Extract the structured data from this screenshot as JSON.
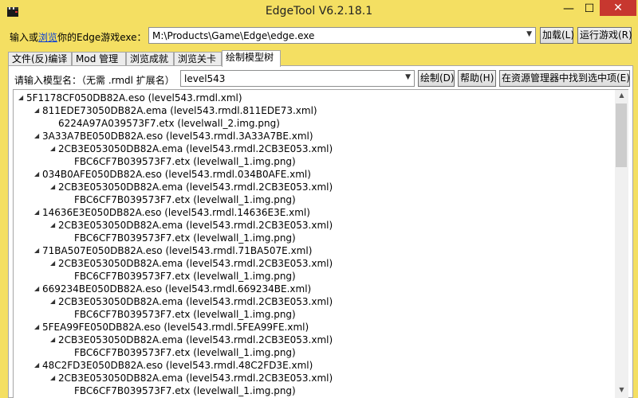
{
  "window": {
    "title": "EdgeTool V6.2.18.1",
    "min": "—",
    "max": "☐",
    "close": "✕"
  },
  "exe": {
    "label_pre": "输入或",
    "label_link": "浏览",
    "label_post": "你的Edge游戏exe：",
    "path": "M:\\Products\\Game\\Edge\\edge.exe",
    "load": "加载(L)",
    "run": "运行游戏(R)"
  },
  "tabs": [
    "文件(反)编译",
    "Mod 管理",
    "浏览成就",
    "浏览关卡",
    "绘制模型树"
  ],
  "model": {
    "label": "请输入模型名：（无需 .rmdl 扩展名）",
    "value": "level543",
    "draw": "绘制(D)",
    "help": "帮助(H)",
    "locate": "在资源管理器中找到选中项(E)"
  },
  "tree": [
    {
      "level": 0,
      "expanded": true,
      "text": "5F1178CF050DB82A.eso (level543.rmdl.xml)"
    },
    {
      "level": 1,
      "expanded": true,
      "text": "811EDE73050DB82A.ema (level543.rmdl.811EDE73.xml)"
    },
    {
      "level": 2,
      "expanded": false,
      "text": "6224A97A039573F7.etx (levelwall_2.img.png)"
    },
    {
      "level": 1,
      "expanded": true,
      "text": "3A33A7BE050DB82A.eso (level543.rmdl.3A33A7BE.xml)"
    },
    {
      "level": 2,
      "expanded": true,
      "text": "2CB3E053050DB82A.ema (level543.rmdl.2CB3E053.xml)"
    },
    {
      "level": 3,
      "expanded": false,
      "text": "FBC6CF7B039573F7.etx (levelwall_1.img.png)"
    },
    {
      "level": 1,
      "expanded": true,
      "text": "034B0AFE050DB82A.eso (level543.rmdl.034B0AFE.xml)"
    },
    {
      "level": 2,
      "expanded": true,
      "text": "2CB3E053050DB82A.ema (level543.rmdl.2CB3E053.xml)"
    },
    {
      "level": 3,
      "expanded": false,
      "text": "FBC6CF7B039573F7.etx (levelwall_1.img.png)"
    },
    {
      "level": 1,
      "expanded": true,
      "text": "14636E3E050DB82A.eso (level543.rmdl.14636E3E.xml)"
    },
    {
      "level": 2,
      "expanded": true,
      "text": "2CB3E053050DB82A.ema (level543.rmdl.2CB3E053.xml)"
    },
    {
      "level": 3,
      "expanded": false,
      "text": "FBC6CF7B039573F7.etx (levelwall_1.img.png)"
    },
    {
      "level": 1,
      "expanded": true,
      "text": "71BA507E050DB82A.eso (level543.rmdl.71BA507E.xml)"
    },
    {
      "level": 2,
      "expanded": true,
      "text": "2CB3E053050DB82A.ema (level543.rmdl.2CB3E053.xml)"
    },
    {
      "level": 3,
      "expanded": false,
      "text": "FBC6CF7B039573F7.etx (levelwall_1.img.png)"
    },
    {
      "level": 1,
      "expanded": true,
      "text": "669234BE050DB82A.eso (level543.rmdl.669234BE.xml)"
    },
    {
      "level": 2,
      "expanded": true,
      "text": "2CB3E053050DB82A.ema (level543.rmdl.2CB3E053.xml)"
    },
    {
      "level": 3,
      "expanded": false,
      "text": "FBC6CF7B039573F7.etx (levelwall_1.img.png)"
    },
    {
      "level": 1,
      "expanded": true,
      "text": "5FEA99FE050DB82A.eso (level543.rmdl.5FEA99FE.xml)"
    },
    {
      "level": 2,
      "expanded": true,
      "text": "2CB3E053050DB82A.ema (level543.rmdl.2CB3E053.xml)"
    },
    {
      "level": 3,
      "expanded": false,
      "text": "FBC6CF7B039573F7.etx (levelwall_1.img.png)"
    },
    {
      "level": 1,
      "expanded": true,
      "text": "48C2FD3E050DB82A.eso (level543.rmdl.48C2FD3E.xml)"
    },
    {
      "level": 2,
      "expanded": true,
      "text": "2CB3E053050DB82A.ema (level543.rmdl.2CB3E053.xml)"
    },
    {
      "level": 3,
      "expanded": false,
      "text": "FBC6CF7B039573F7.etx (levelwall_1.img.png)"
    }
  ],
  "colors": {
    "frame": "#f4df62",
    "close": "#c7372f",
    "link": "#0a3fd6"
  },
  "icons": {
    "app": "clapperboard-icon",
    "expand": "triangle-down-icon",
    "scroll_up": "arrow-up-icon",
    "scroll_down": "arrow-down-icon"
  }
}
